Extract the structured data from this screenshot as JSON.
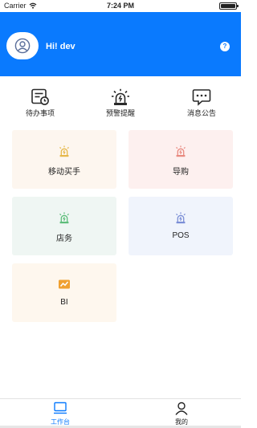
{
  "status_bar": {
    "carrier": "Carrier",
    "time": "7:24 PM",
    "battery_level": 1.0
  },
  "header": {
    "username": "Hi! dev",
    "avatar_icon": "user-avatar-icon",
    "help_icon": "question-icon",
    "help_glyph": "?",
    "background_color": "#0a7afe"
  },
  "quick_actions": [
    {
      "label": "待办事项",
      "icon": "todo-list-icon"
    },
    {
      "label": "预警提醒",
      "icon": "alarm-light-icon"
    },
    {
      "label": "消息公告",
      "icon": "message-icon"
    }
  ],
  "modules": [
    {
      "label": "移动买手",
      "icon": "alarm-light-icon",
      "icon_color": "#e6b84a",
      "bg_color": "#fdf6ef"
    },
    {
      "label": "导购",
      "icon": "alarm-light-icon",
      "icon_color": "#e88a80",
      "bg_color": "#fdf0ef"
    },
    {
      "label": "店务",
      "icon": "alarm-light-icon",
      "icon_color": "#5dbd7a",
      "bg_color": "#eff6f3"
    },
    {
      "label": "POS",
      "icon": "alarm-light-icon",
      "icon_color": "#7b8ed6",
      "bg_color": "#f0f4fc"
    },
    {
      "label": "BI",
      "icon": "chart-icon",
      "icon_color": "#f0a030",
      "bg_color": "#fef7ee"
    }
  ],
  "tab_bar": {
    "tabs": [
      {
        "label": "工作台",
        "icon": "monitor-icon",
        "active": true,
        "color": "#0a7afe"
      },
      {
        "label": "我的",
        "icon": "person-icon",
        "active": false,
        "color": "#222222"
      }
    ]
  }
}
